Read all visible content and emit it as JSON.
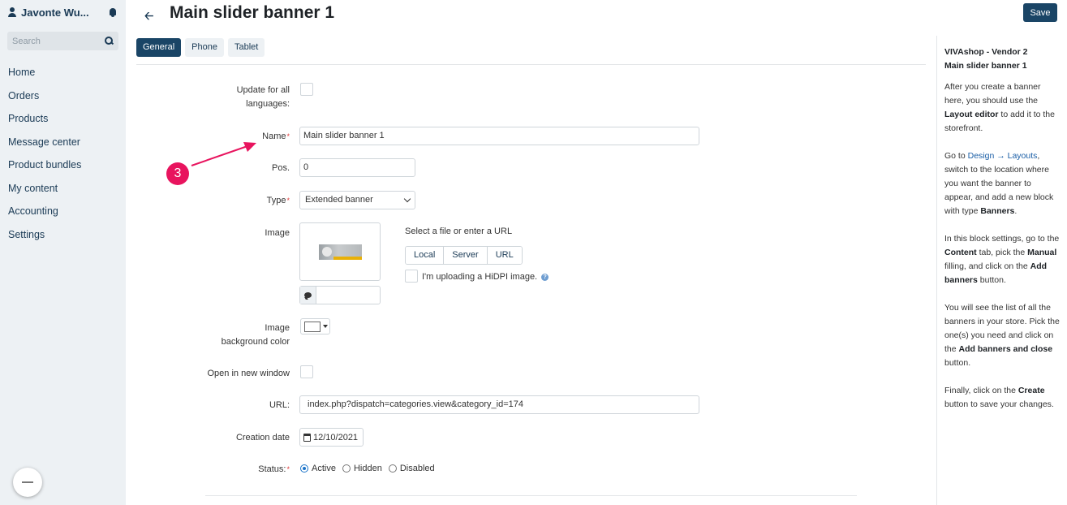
{
  "sidebar": {
    "user_name": "Javonte Wu...",
    "search_placeholder": "Search",
    "items": [
      {
        "label": "Home"
      },
      {
        "label": "Orders"
      },
      {
        "label": "Products"
      },
      {
        "label": "Message center"
      },
      {
        "label": "Product bundles"
      },
      {
        "label": "My content"
      },
      {
        "label": "Accounting"
      },
      {
        "label": "Settings"
      }
    ]
  },
  "header": {
    "title": "Main slider banner 1",
    "save_label": "Save"
  },
  "tabs": [
    {
      "label": "General",
      "active": true
    },
    {
      "label": "Phone",
      "active": false
    },
    {
      "label": "Tablet",
      "active": false
    }
  ],
  "form": {
    "update_all_languages_label": "Update for all languages:",
    "update_all_languages_checked": false,
    "name_label": "Name",
    "name_value": "Main slider banner 1",
    "pos_label": "Pos.",
    "pos_value": "0",
    "type_label": "Type",
    "type_value": "Extended banner",
    "image_label": "Image",
    "select_file_text": "Select a file or enter a URL",
    "file_buttons": [
      "Local",
      "Server",
      "URL"
    ],
    "hidpi_label": "I'm uploading a HiDPI image.",
    "image_bg_label": "Image background color",
    "image_bg_color": "#ffffff",
    "open_new_window_label": "Open in new window",
    "url_label": "URL:",
    "url_value": "index.php?dispatch=categories.view&category_id=174",
    "creation_date_label": "Creation date",
    "creation_date_value": "12/10/2021",
    "status_label": "Status:",
    "status_options": [
      "Active",
      "Hidden",
      "Disabled"
    ],
    "status_selected": "Active"
  },
  "annotation": {
    "step_number": "3",
    "color": "#e8145e"
  },
  "right_panel": {
    "heading_line1": "VIVAshop - Vendor 2",
    "heading_line2": "Main slider banner 1",
    "p1_a": "After you create a banner here, you should use the ",
    "p1_b": "Layout editor",
    "p1_c": " to add it to the storefront.",
    "p2_a": "Go to ",
    "p2_link": "Design → Layouts",
    "p2_b": ", switch to the location where you want the banner to appear, and add a new block with type ",
    "p2_c": "Banners",
    "p2_d": ".",
    "p3_a": "In this block settings, go to the ",
    "p3_b": "Content",
    "p3_c": " tab, pick the ",
    "p3_d": "Manual",
    "p3_e": " filling, and click on the ",
    "p3_f": "Add banners",
    "p3_g": " button.",
    "p4_a": "You will see the list of all the banners in your store. Pick the one(s) you need and click on the ",
    "p4_b": "Add banners and close",
    "p4_c": " button.",
    "p5_a": "Finally, click on the ",
    "p5_b": "Create",
    "p5_c": " button to save your changes."
  },
  "colors": {
    "primary": "#1a4566",
    "sidebar_bg": "#edf1f4",
    "link": "#1a5ea6",
    "required": "#e03a3a"
  }
}
